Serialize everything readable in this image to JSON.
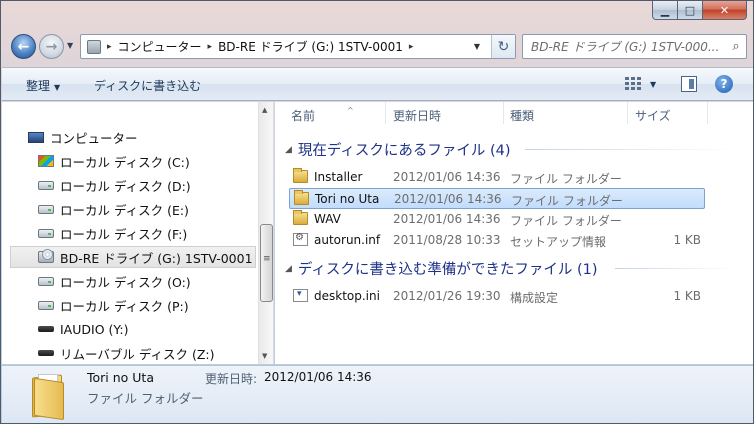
{
  "window": {
    "minimize_glyph": "▁",
    "maximize_glyph": "□",
    "close_glyph": "✕"
  },
  "nav": {
    "back_glyph": "←",
    "forward_glyph": "→",
    "dropdown_glyph": "▼"
  },
  "address": {
    "sep": "▸",
    "crumbs": [
      "コンピューター",
      "BD-RE ドライブ (G:) 1STV-0001"
    ],
    "dropdown_glyph": "▼",
    "refresh_glyph": "↻"
  },
  "search": {
    "placeholder": "BD-RE ドライブ (G:) 1STV-000...",
    "icon_glyph": "⌕"
  },
  "toolbar": {
    "organize_label": "整理",
    "arrow": "▼",
    "burn_label": "ディスクに書き込む",
    "view_arrow": "▼",
    "help_glyph": "?"
  },
  "sidebar": {
    "items": [
      {
        "label": "コンピューター",
        "icon": "computer-icon"
      },
      {
        "label": "ローカル ディスク (C:)",
        "icon": "system-drive-icon"
      },
      {
        "label": "ローカル ディスク (D:)",
        "icon": "drive-icon"
      },
      {
        "label": "ローカル ディスク (E:)",
        "icon": "drive-icon"
      },
      {
        "label": "ローカル ディスク (F:)",
        "icon": "drive-icon"
      },
      {
        "label": "BD-RE ドライブ (G:) 1STV-0001",
        "icon": "disc-drive-icon",
        "selected": true
      },
      {
        "label": "ローカル ディスク (O:)",
        "icon": "drive-icon"
      },
      {
        "label": "ローカル ディスク (P:)",
        "icon": "drive-icon"
      },
      {
        "label": "IAUDIO (Y:)",
        "icon": "usb-drive-icon"
      },
      {
        "label": "リムーバブル ディスク (Z:)",
        "icon": "usb-drive-icon"
      }
    ],
    "scroll_up": "▲",
    "scroll_down": "▼"
  },
  "columns": {
    "name": "名前",
    "date": "更新日時",
    "type": "種類",
    "size": "サイズ",
    "sort_glyph": "^"
  },
  "groups": [
    {
      "title": "現在ディスクにあるファイル (4)",
      "toggle": "◢",
      "files": [
        {
          "name": "Installer",
          "date": "2012/01/06 14:36",
          "type": "ファイル フォルダー",
          "size": "",
          "icon": "folder-icon"
        },
        {
          "name": "Tori no Uta",
          "date": "2012/01/06 14:36",
          "type": "ファイル フォルダー",
          "size": "",
          "icon": "folder-icon",
          "selected": true
        },
        {
          "name": "WAV",
          "date": "2012/01/06 14:36",
          "type": "ファイル フォルダー",
          "size": "",
          "icon": "folder-icon"
        },
        {
          "name": "autorun.inf",
          "date": "2011/08/28 10:33",
          "type": "セットアップ情報",
          "size": "1 KB",
          "icon": "setup-info-icon"
        }
      ]
    },
    {
      "title": "ディスクに書き込む準備ができたファイル (1)",
      "toggle": "◢",
      "files": [
        {
          "name": "desktop.ini",
          "date": "2012/01/26 19:30",
          "type": "構成設定",
          "size": "1 KB",
          "icon": "config-file-icon"
        }
      ]
    }
  ],
  "details": {
    "name": "Tori no Uta",
    "type": "ファイル フォルダー",
    "modified_label": "更新日時:",
    "modified_value": "2012/01/06 14:36"
  }
}
